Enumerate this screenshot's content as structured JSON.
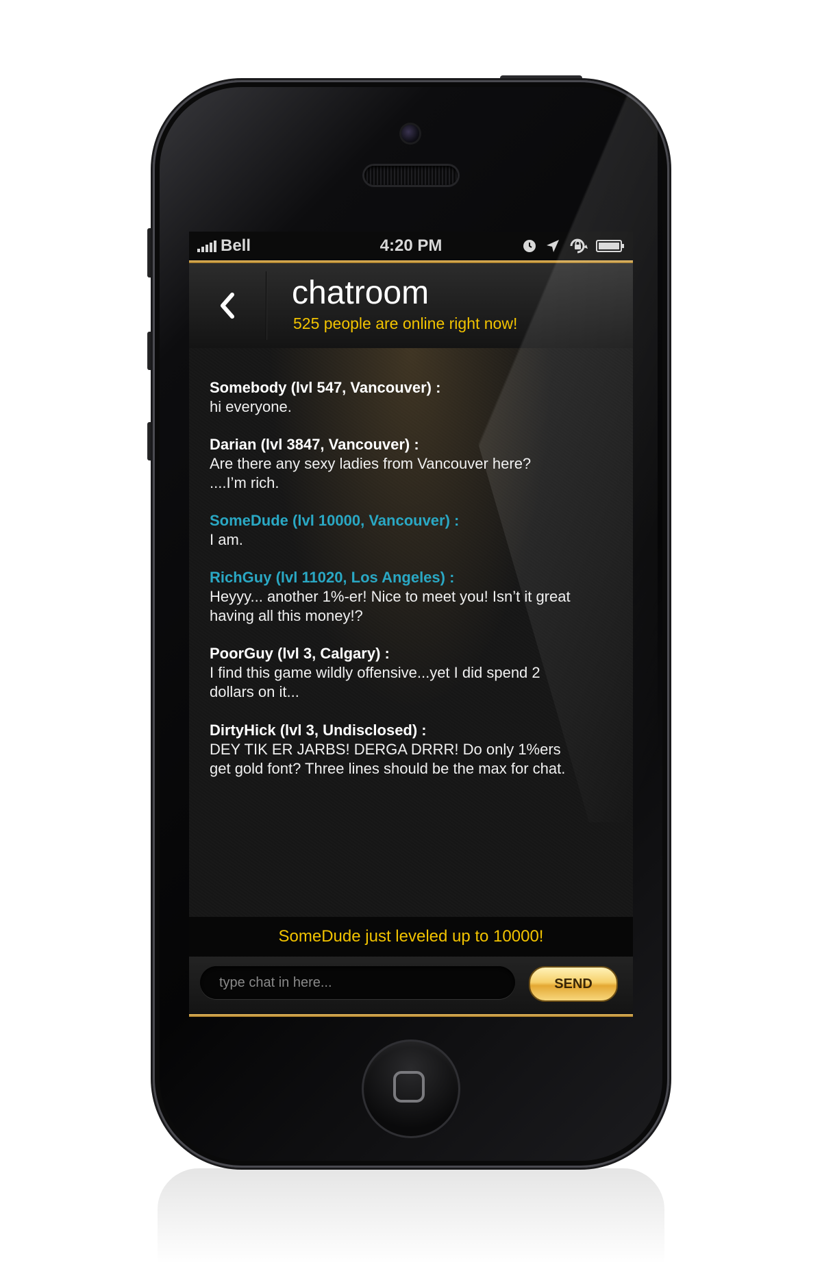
{
  "status_bar": {
    "carrier": "Bell",
    "time": "4:20 PM",
    "icons": [
      "signal-bars-icon",
      "alarm-clock-icon",
      "location-arrow-icon",
      "rotation-lock-icon",
      "battery-icon"
    ]
  },
  "nav": {
    "back_icon": "chevron-left-icon",
    "title": "chatroom",
    "subtitle": "525 people are online right now!"
  },
  "messages": [
    {
      "author": "Somebody (lvl 547, Vancouver) :",
      "text_lines": [
        "hi everyone."
      ],
      "style": "normal"
    },
    {
      "author": "Darian (lvl 3847, Vancouver) :",
      "text_lines": [
        "Are there any sexy ladies from Vancouver here?",
        "....I’m rich."
      ],
      "style": "normal"
    },
    {
      "author": "SomeDude (lvl 10000, Vancouver) :",
      "text_lines": [
        "I am."
      ],
      "style": "premium"
    },
    {
      "author": "RichGuy (lvl 11020, Los Angeles) :",
      "text_lines": [
        "Heyyy... another 1%-er! Nice to meet you! Isn’t it great",
        "having all this money!?"
      ],
      "style": "premium"
    },
    {
      "author": "PoorGuy (lvl 3, Calgary) :",
      "text_lines": [
        "I find this game wildly offensive...yet I did spend 2",
        "dollars on it..."
      ],
      "style": "normal"
    },
    {
      "author": "DirtyHick (lvl 3, Undisclosed) :",
      "text_lines": [
        "DEY TIK ER JARBS! DERGA DRRR! Do only 1%ers",
        "get gold font? Three lines should be the max for chat."
      ],
      "style": "normal"
    }
  ],
  "announcement": "SomeDude just leveled up to 10000!",
  "input": {
    "placeholder": "type chat in here...",
    "value": ""
  },
  "send_label": "SEND",
  "colors": {
    "accent_gold": "#f2c300",
    "premium_name": "#2aa8c4",
    "normal_name": "#ffffff",
    "background": "#161616"
  }
}
